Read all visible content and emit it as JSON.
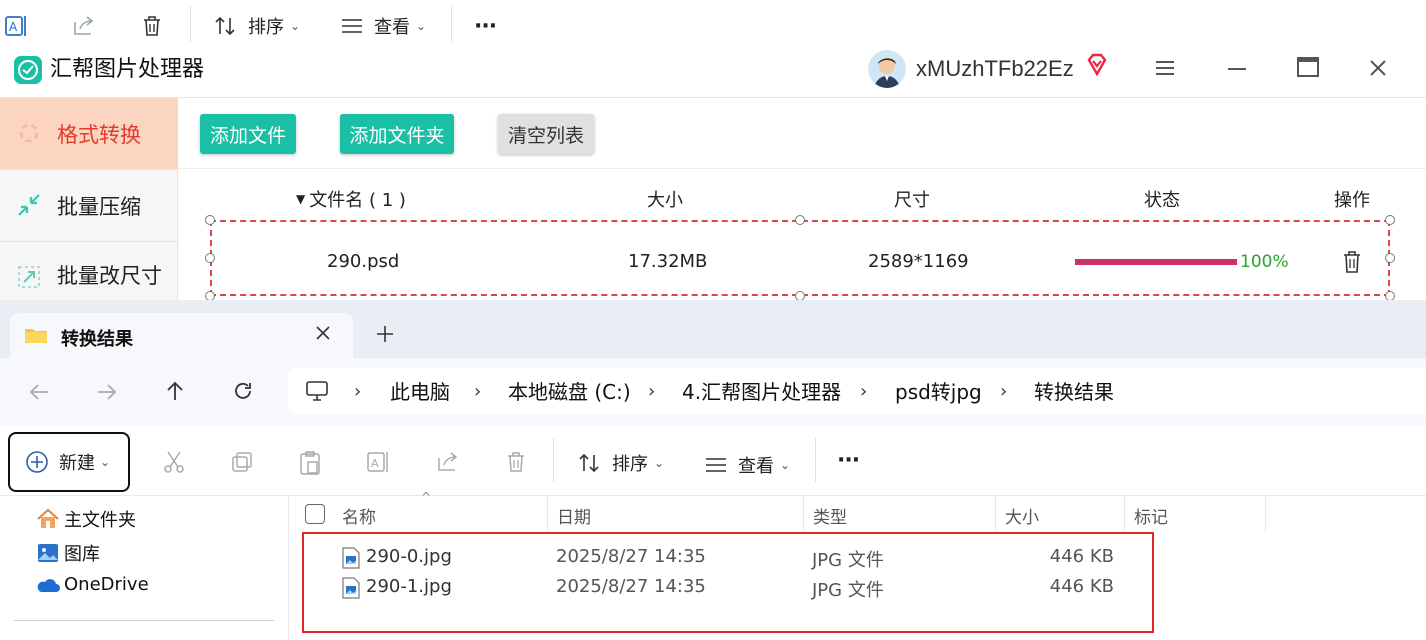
{
  "top_toolbar": {
    "sort_label": "排序",
    "view_label": "查看",
    "more_label": "···"
  },
  "app": {
    "title": "汇帮图片处理器",
    "username": "xMUzhTFb22Ez",
    "sidebar": [
      {
        "label": "格式转换",
        "active": true
      },
      {
        "label": "批量压缩",
        "active": false
      },
      {
        "label": "批量改尺寸",
        "active": false
      }
    ],
    "buttons": {
      "add_file": "添加文件",
      "add_folder": "添加文件夹",
      "clear_list": "清空列表"
    },
    "table": {
      "headers": {
        "name": "文件名 ( 1 )",
        "size": "大小",
        "dims": "尺寸",
        "status": "状态",
        "action": "操作"
      },
      "rows": [
        {
          "name": "290.psd",
          "size": "17.32MB",
          "dims": "2589*1169",
          "progress": 100,
          "progress_label": "100%"
        }
      ]
    },
    "colors": {
      "accent": "#1bbfa6",
      "active_side_bg": "#fbd5bf",
      "active_side_text": "#e53a2c",
      "progress": "#d0306a",
      "percent": "#2aa52a"
    }
  },
  "explorer": {
    "tab_title": "转换结果",
    "breadcrumb": [
      "此电脑",
      "本地磁盘 (C:)",
      "4.汇帮图片处理器",
      "psd转jpg",
      "转换结果"
    ],
    "new_label": "新建",
    "sort_label": "排序",
    "view_label": "查看",
    "more_label": "···",
    "nav": [
      {
        "label": "主文件夹",
        "icon": "home-icon"
      },
      {
        "label": "图库",
        "icon": "gallery-icon"
      },
      {
        "label": "OneDrive",
        "icon": "cloud-icon"
      }
    ],
    "columns": {
      "name": "名称",
      "date": "日期",
      "type": "类型",
      "size": "大小",
      "tag": "标记"
    },
    "files": [
      {
        "name": "290-0.jpg",
        "date": "2025/8/27 14:35",
        "type": "JPG 文件",
        "size": "446 KB"
      },
      {
        "name": "290-1.jpg",
        "date": "2025/8/27 14:35",
        "type": "JPG 文件",
        "size": "446 KB"
      }
    ]
  }
}
